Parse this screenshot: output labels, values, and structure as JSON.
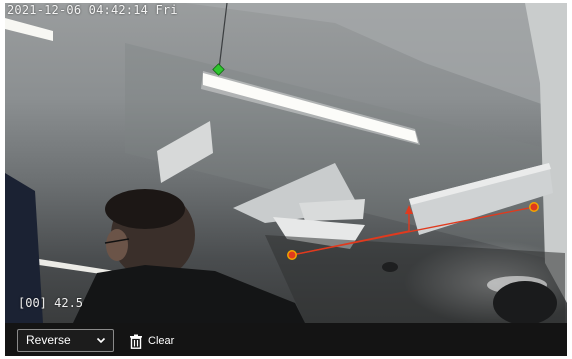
{
  "osd": {
    "timestamp": "2021-12-06 04:42:14 Fri",
    "reading": "[00] 42.5"
  },
  "toolbar": {
    "direction_selected": "Reverse",
    "clear_label": "Clear"
  },
  "icons": {
    "dropdown": "chevron-down-icon",
    "clear": "trash-icon"
  },
  "colors": {
    "line_point": "#e03a1e",
    "line_point_edge": "#f2a600",
    "anchor_marker": "#2fc52f",
    "toolbar_bg": "#141414"
  }
}
